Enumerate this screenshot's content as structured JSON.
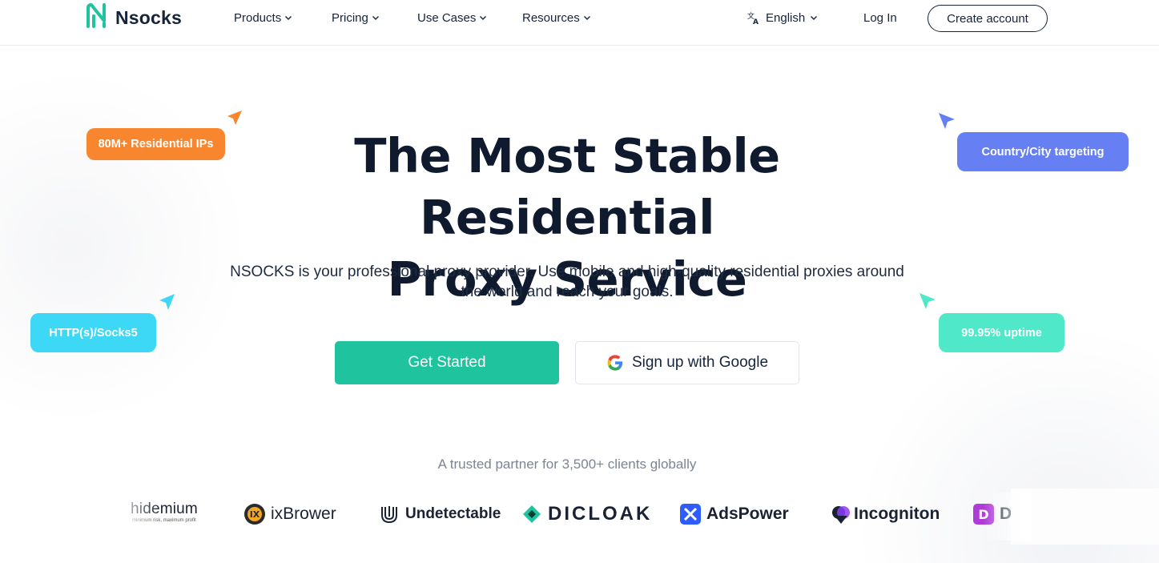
{
  "brand": {
    "name": "Nsocks",
    "accent": "#1fc39d",
    "logo_icon": "nsocks-logo-icon"
  },
  "nav": {
    "items": [
      {
        "label": "Products"
      },
      {
        "label": "Pricing"
      },
      {
        "label": "Use Cases"
      },
      {
        "label": "Resources"
      }
    ],
    "language": "English",
    "login": "Log In",
    "create_account": "Create account"
  },
  "hero": {
    "title_line1": "The Most Stable Residential",
    "title_line2": "Proxy Service",
    "subtitle_line1": "NSOCKS is your professional proxy provider. Use mobile and high-quality residential proxies around",
    "subtitle_line2": "the world and reach your goals.",
    "cta_primary": "Get Started",
    "cta_google": "Sign up with Google"
  },
  "badges": [
    {
      "label": "80M+ Residential IPs",
      "color": "#f7862f"
    },
    {
      "label": "Country/City targeting",
      "color": "#6680f4"
    },
    {
      "label": "HTTP(s)/Socks5",
      "color": "#3dd8f5"
    },
    {
      "label": "99.95% uptime",
      "color": "#4fe8c8"
    }
  ],
  "trusted": {
    "text": "A trusted partner for 3,500+ clients globally",
    "partners": [
      {
        "name": "hidemium",
        "tagline": "minimum risk, maximum profit"
      },
      {
        "name": "ixBrower"
      },
      {
        "name": "Undetectable"
      },
      {
        "name": "DICLOAK"
      },
      {
        "name": "AdsPower"
      },
      {
        "name": "Incogniton"
      },
      {
        "name": "D"
      }
    ]
  }
}
